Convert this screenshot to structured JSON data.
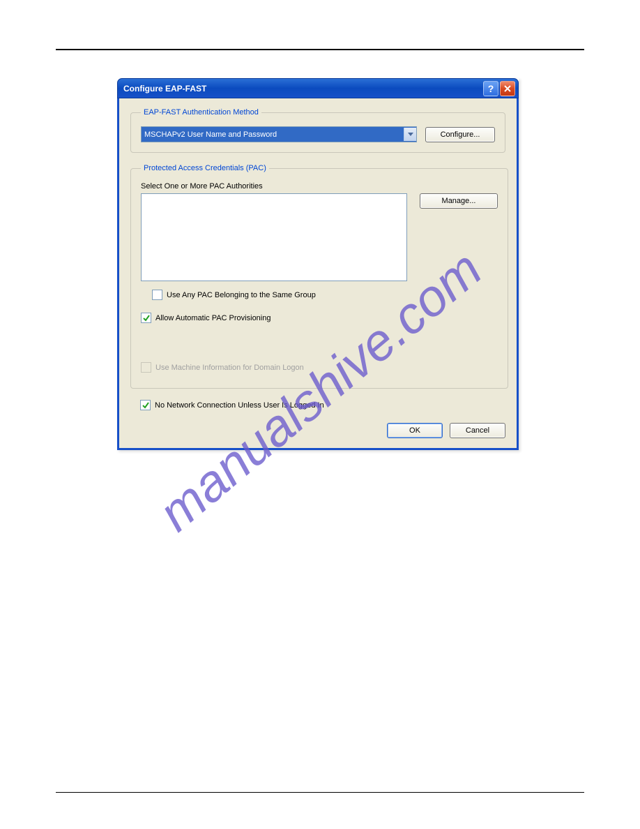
{
  "watermark": "manualshive.com",
  "dialog": {
    "title": "Configure EAP-FAST",
    "auth_group": {
      "legend": "EAP-FAST Authentication Method",
      "dropdown_value": "MSCHAPv2 User Name and Password",
      "configure_label": "Configure..."
    },
    "pac_group": {
      "legend": "Protected Access Credentials (PAC)",
      "select_label": "Select One or More PAC Authorities",
      "manage_label": "Manage...",
      "use_any_pac_label": "Use Any PAC Belonging to the Same Group",
      "use_any_pac_checked": false,
      "allow_auto_label": "Allow Automatic PAC Provisioning",
      "allow_auto_checked": true,
      "use_machine_label": "Use Machine Information for Domain Logon",
      "use_machine_checked": false
    },
    "no_network_label": "No Network Connection Unless User Is Logged In",
    "no_network_checked": true,
    "ok_label": "OK",
    "cancel_label": "Cancel",
    "help_symbol": "?"
  }
}
